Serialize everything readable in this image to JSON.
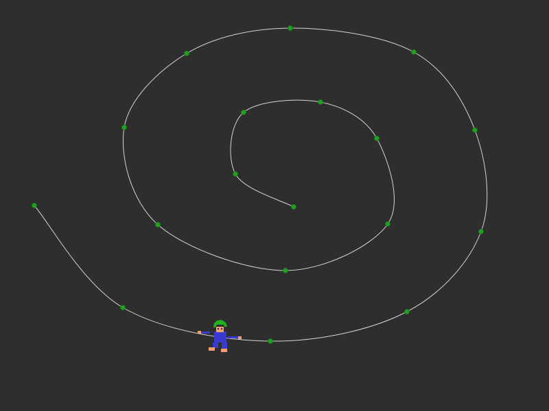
{
  "scene": {
    "background": "#2e2e2e",
    "path_color": "#d6d6d6",
    "node_color": "#22a022",
    "node_stroke": "#1a7a1a",
    "waypoint_count": 18
  },
  "character": {
    "icon": "lemming-character-icon",
    "hair_color": "#22b022",
    "skin_color": "#f0a070",
    "robe_color": "#3a3ad0"
  }
}
